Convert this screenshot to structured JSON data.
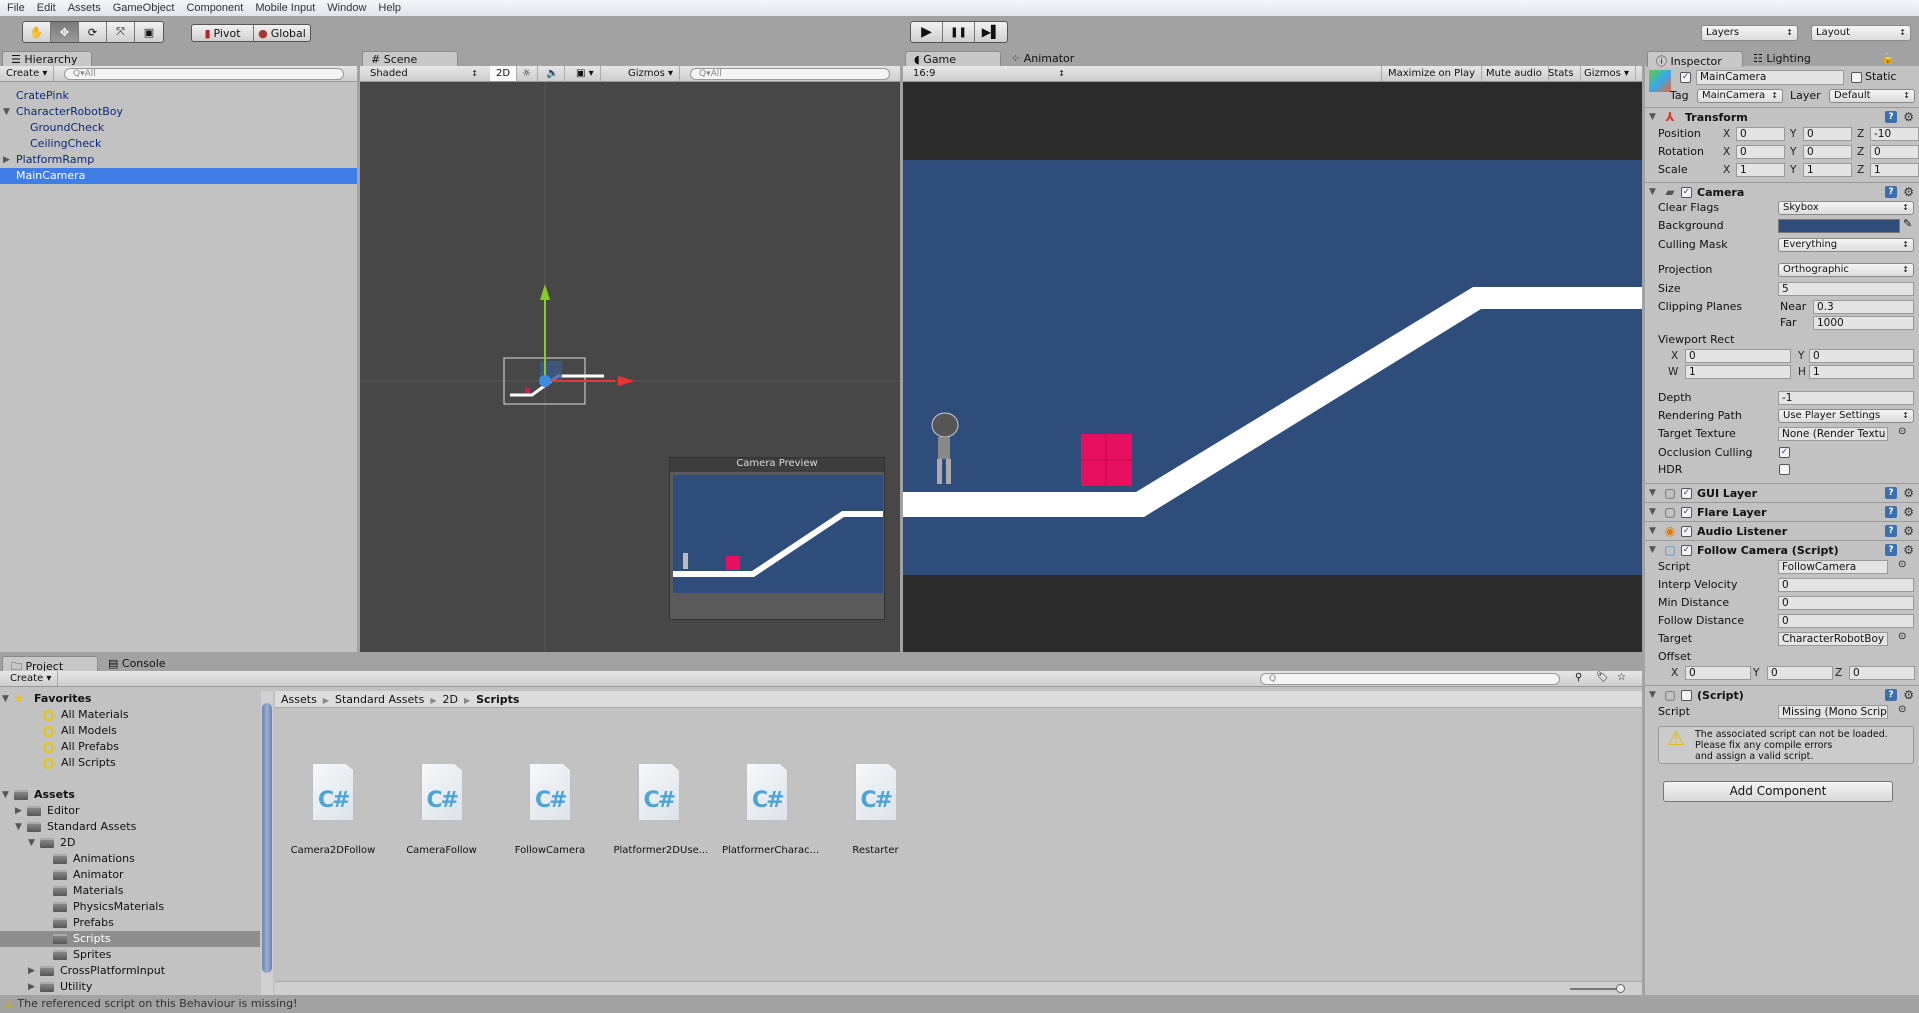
{
  "menu": [
    "File",
    "Edit",
    "Assets",
    "GameObject",
    "Component",
    "Mobile Input",
    "Window",
    "Help"
  ],
  "toolbar": {
    "tools": [
      "hand-tool",
      "move-tool",
      "rotate-tool",
      "scale-tool",
      "rect-tool"
    ],
    "pivot": "Pivot",
    "global": "Global",
    "play": "▶",
    "pause": "❚❚",
    "step": "▶▌",
    "layers": "Layers",
    "layout": "Layout"
  },
  "hierarchy": {
    "tab": "Hierarchy",
    "create": "Create",
    "search": "All",
    "items": [
      {
        "label": "CratePink",
        "depth": 0,
        "fold": ""
      },
      {
        "label": "CharacterRobotBoy",
        "depth": 0,
        "fold": "open"
      },
      {
        "label": "GroundCheck",
        "depth": 1,
        "fold": ""
      },
      {
        "label": "CeilingCheck",
        "depth": 1,
        "fold": ""
      },
      {
        "label": "PlatformRamp",
        "depth": 0,
        "fold": "closed"
      },
      {
        "label": "MainCamera",
        "depth": 0,
        "fold": "",
        "selected": true
      }
    ]
  },
  "scene": {
    "tab": "Scene",
    "shading": "Shaded",
    "mode2d": "2D",
    "gizmos": "Gizmos",
    "search": "All",
    "preview_title": "Camera Preview"
  },
  "game": {
    "tab": "Game",
    "tab2": "Animator",
    "aspect": "16:9",
    "maximize": "Maximize on Play",
    "mute": "Mute audio",
    "stats": "Stats",
    "gizmos": "Gizmos",
    "sky_color": "#2f4d7a",
    "crate_color": "#e8105e"
  },
  "inspector": {
    "tab": "Inspector",
    "tab2": "Lighting",
    "name": "MainCamera",
    "static": "Static",
    "tag_label": "Tag",
    "tag": "MainCamera",
    "layer_label": "Layer",
    "layer": "Default",
    "transform": {
      "title": "Transform",
      "rows": [
        {
          "label": "Position",
          "x": "0",
          "y": "0",
          "z": "-10"
        },
        {
          "label": "Rotation",
          "x": "0",
          "y": "0",
          "z": "0"
        },
        {
          "label": "Scale",
          "x": "1",
          "y": "1",
          "z": "1"
        }
      ]
    },
    "camera": {
      "title": "Camera",
      "clear_flags_label": "Clear Flags",
      "clear_flags": "Skybox",
      "background_label": "Background",
      "background_color": "#2f4d7a",
      "culling_label": "Culling Mask",
      "culling": "Everything",
      "projection_label": "Projection",
      "projection": "Orthographic",
      "size_label": "Size",
      "size": "5",
      "clipping_label": "Clipping Planes",
      "near_label": "Near",
      "near": "0.3",
      "far_label": "Far",
      "far": "1000",
      "viewport_label": "Viewport Rect",
      "vx": "0",
      "vy": "0",
      "vw": "1",
      "vh": "1",
      "depth_label": "Depth",
      "depth": "-1",
      "rendering_label": "Rendering Path",
      "rendering": "Use Player Settings",
      "target_label": "Target Texture",
      "target": "None (Render Textu",
      "occlusion_label": "Occlusion Culling",
      "occlusion": true,
      "hdr_label": "HDR",
      "hdr": false
    },
    "gui_layer": "GUI Layer",
    "flare_layer": "Flare Layer",
    "audio_listener": "Audio Listener",
    "follow": {
      "title": "Follow Camera (Script)",
      "script_label": "Script",
      "script": "FollowCamera",
      "interp_label": "Interp Velocity",
      "interp": "0",
      "min_label": "Min Distance",
      "min": "0",
      "follow_label": "Follow Distance",
      "follow": "0",
      "target_label": "Target",
      "target": "CharacterRobotBoy",
      "offset_label": "Offset",
      "ox": "0",
      "oy": "0",
      "oz": "0"
    },
    "missing": {
      "title": "(Script)",
      "script_label": "Script",
      "script": "Missing (Mono Script",
      "warning": [
        "The associated script can not be loaded.",
        "Please fix any compile errors",
        "and assign a valid script."
      ]
    },
    "add_component": "Add Component"
  },
  "project": {
    "tab": "Project",
    "tab2": "Console",
    "create": "Create",
    "tree": [
      {
        "label": "Favorites",
        "depth": 0,
        "icon": "star",
        "bold": true,
        "fold": "open"
      },
      {
        "label": "All Materials",
        "depth": 1,
        "icon": "search"
      },
      {
        "label": "All Models",
        "depth": 1,
        "icon": "search"
      },
      {
        "label": "All Prefabs",
        "depth": 1,
        "icon": "search"
      },
      {
        "label": "All Scripts",
        "depth": 1,
        "icon": "search"
      },
      {
        "label": "Assets",
        "depth": 0,
        "icon": "folder",
        "bold": true,
        "fold": "open",
        "gap": true
      },
      {
        "label": "Editor",
        "depth": 1,
        "icon": "folder",
        "fold": "closed"
      },
      {
        "label": "Standard Assets",
        "depth": 1,
        "icon": "folder",
        "fold": "open"
      },
      {
        "label": "2D",
        "depth": 2,
        "icon": "folder",
        "fold": "open"
      },
      {
        "label": "Animations",
        "depth": 3,
        "icon": "folder"
      },
      {
        "label": "Animator",
        "depth": 3,
        "icon": "folder"
      },
      {
        "label": "Materials",
        "depth": 3,
        "icon": "folder"
      },
      {
        "label": "PhysicsMaterials",
        "depth": 3,
        "icon": "folder"
      },
      {
        "label": "Prefabs",
        "depth": 3,
        "icon": "folder"
      },
      {
        "label": "Scripts",
        "depth": 3,
        "icon": "folder",
        "selected": true
      },
      {
        "label": "Sprites",
        "depth": 3,
        "icon": "folder"
      },
      {
        "label": "CrossPlatformInput",
        "depth": 2,
        "icon": "folder",
        "fold": "closed"
      },
      {
        "label": "Utility",
        "depth": 2,
        "icon": "folder",
        "fold": "closed"
      }
    ],
    "breadcrumb": [
      "Assets",
      "Standard Assets",
      "2D",
      "Scripts"
    ],
    "scripts": [
      "Camera2DFollow",
      "CameraFollow",
      "FollowCamera",
      "Platformer2DUse...",
      "PlatformerCharac...",
      "Restarter"
    ]
  },
  "status": "The referenced script on this Behaviour is missing!"
}
